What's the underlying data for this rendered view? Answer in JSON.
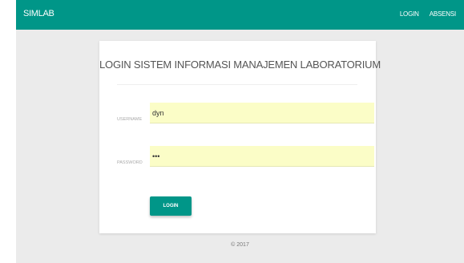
{
  "header": {
    "brand": "SIMLAB",
    "nav": [
      {
        "label": "LOGIN"
      },
      {
        "label": "ABSENSI"
      }
    ]
  },
  "login_card": {
    "title": "LOGIN SISTEM INFORMASI MANAJEMEN LABORATORIUM",
    "username": {
      "label": "USERNAME",
      "value": "dyn"
    },
    "password": {
      "label": "PASSWORD",
      "value": "•••"
    },
    "submit_label": "LOGIN"
  },
  "footer": {
    "text": "© 2017"
  },
  "colors": {
    "accent": "#009688",
    "background": "#ebebeb",
    "input_fill": "#fbfdc7"
  }
}
